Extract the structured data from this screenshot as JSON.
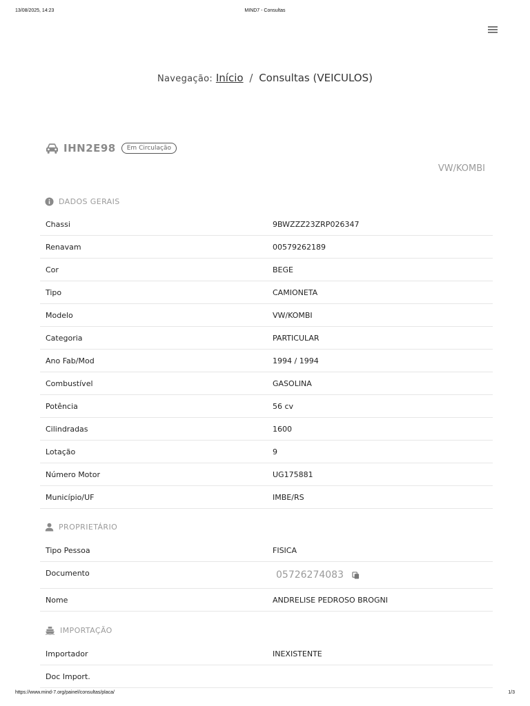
{
  "print": {
    "datetime": "13/08/2025, 14:23",
    "doc_title": "MIND7 - Consultas",
    "url": "https://www.mind-7.org/painel/consultas/placa/",
    "page": "1/3"
  },
  "header": {
    "menu_icon": "hamburger-menu-icon"
  },
  "breadcrumb": {
    "label": "Navegação:",
    "home": "Início",
    "separator": "/",
    "current": "Consultas (VEICULOS)"
  },
  "vehicle": {
    "plate": "IHN2E98",
    "status": "Em Circulação",
    "model": "VW/KOMBI"
  },
  "sections": {
    "dados_gerais": {
      "title": "DADOS GERAIS",
      "rows": [
        {
          "label": "Chassi",
          "value": "9BWZZZ23ZRP026347"
        },
        {
          "label": "Renavam",
          "value": "00579262189"
        },
        {
          "label": "Cor",
          "value": "BEGE"
        },
        {
          "label": "Tipo",
          "value": "CAMIONETA"
        },
        {
          "label": "Modelo",
          "value": "VW/KOMBI"
        },
        {
          "label": "Categoria",
          "value": "PARTICULAR"
        },
        {
          "label": "Ano Fab/Mod",
          "value": "1994 / 1994"
        },
        {
          "label": "Combustível",
          "value": "GASOLINA"
        },
        {
          "label": "Potência",
          "value": "56 cv"
        },
        {
          "label": "Cilindradas",
          "value": "1600"
        },
        {
          "label": "Lotação",
          "value": "9"
        },
        {
          "label": "Número Motor",
          "value": "UG175881"
        },
        {
          "label": "Município/UF",
          "value": "IMBE/RS"
        }
      ]
    },
    "proprietario": {
      "title": "PROPRIETÁRIO",
      "rows": [
        {
          "label": "Tipo Pessoa",
          "value": "FISICA"
        },
        {
          "label": "Documento",
          "value": "05726274083"
        },
        {
          "label": "Nome",
          "value": "ANDRELISE PEDROSO BROGNI"
        }
      ]
    },
    "importacao": {
      "title": "IMPORTAÇÃO",
      "rows": [
        {
          "label": "Importador",
          "value": "INEXISTENTE"
        },
        {
          "label": "Doc Import.",
          "value": ""
        }
      ]
    }
  }
}
